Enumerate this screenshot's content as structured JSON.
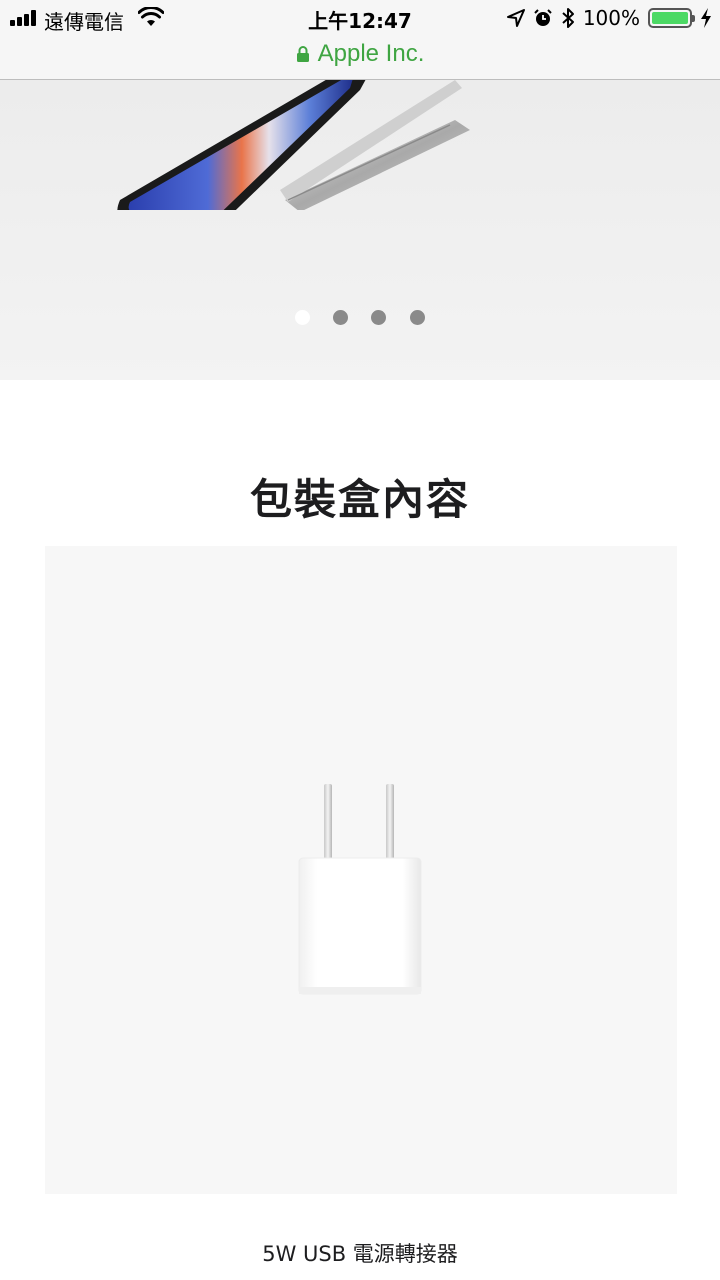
{
  "status_bar": {
    "carrier": "遠傳電信",
    "time": "上午12:47",
    "battery_percent": "100%",
    "battery_level": 1.0,
    "icons": [
      "signal-icon",
      "wifi-icon",
      "location-icon",
      "alarm-icon",
      "bluetooth-icon",
      "battery-icon",
      "charging-icon"
    ]
  },
  "url_bar": {
    "site_name": "Apple Inc.",
    "secure": true
  },
  "hero": {
    "carousel_pages": 4,
    "active_page": 1
  },
  "box_contents": {
    "title": "包裝盒內容",
    "item_caption": "5W USB 電源轉接器"
  },
  "colors": {
    "secure_green": "#3fa542",
    "battery_green": "#4cd964"
  }
}
